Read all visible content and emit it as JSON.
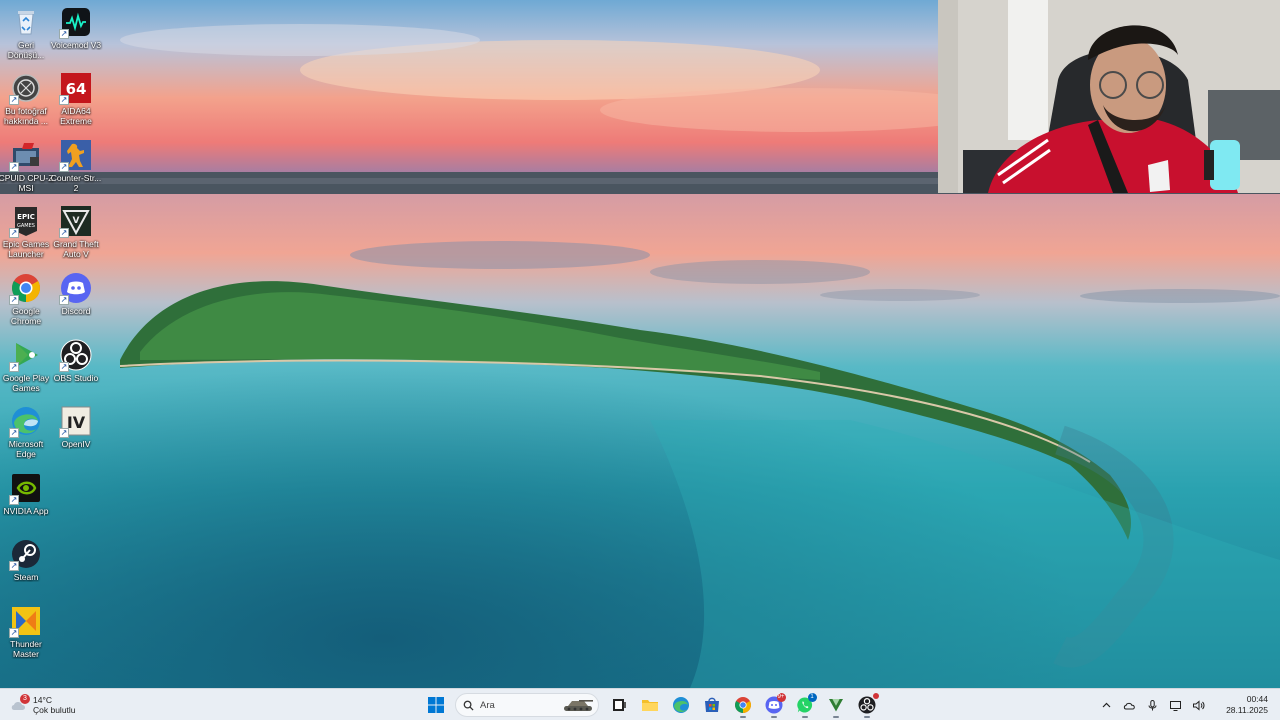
{
  "desktop_icons": [
    {
      "label": "Geri\nDönüşü...",
      "icon": "recycle-bin-icon"
    },
    {
      "label": "Voicemod V3",
      "icon": "voicemod-icon"
    },
    {
      "label": "Bu fotoğraf\nhakkında ...",
      "icon": "about-photo-icon"
    },
    {
      "label": "AIDA64\nExtreme",
      "icon": "aida64-icon"
    },
    {
      "label": "CPUID CPU-Z\nMSI",
      "icon": "cpuz-icon"
    },
    {
      "label": "Counter-Str...\n2",
      "icon": "counter-strike-icon"
    },
    {
      "label": "Epic Games\nLauncher",
      "icon": "epic-games-icon"
    },
    {
      "label": "Grand Theft\nAuto V",
      "icon": "gta-icon"
    },
    {
      "label": "Google\nChrome",
      "icon": "chrome-icon"
    },
    {
      "label": "Discord",
      "icon": "discord-icon"
    },
    {
      "label": "Google Play\nGames",
      "icon": "google-play-games-icon"
    },
    {
      "label": "OBS Studio",
      "icon": "obs-icon"
    },
    {
      "label": "Microsoft\nEdge",
      "icon": "edge-icon"
    },
    {
      "label": "OpenIV",
      "icon": "openiv-icon"
    },
    {
      "label": "NVIDIA App",
      "icon": "nvidia-icon"
    },
    {
      "label": "Steam",
      "icon": "steam-icon"
    },
    {
      "label": "Thunder\nMaster",
      "icon": "thunder-master-icon"
    }
  ],
  "taskbar": {
    "weather": {
      "temp": "14°C",
      "condition": "Çok bulutlu",
      "badge": "3"
    },
    "search": {
      "placeholder": "Ara"
    },
    "apps": [
      {
        "name": "start-button",
        "icon": "windows-logo-icon"
      },
      {
        "name": "task-view",
        "icon": "task-view-icon"
      },
      {
        "name": "file-explorer",
        "icon": "folder-icon"
      },
      {
        "name": "edge",
        "icon": "edge-icon"
      },
      {
        "name": "microsoft-store",
        "icon": "store-icon"
      },
      {
        "name": "chrome",
        "icon": "chrome-icon"
      },
      {
        "name": "discord",
        "icon": "discord-icon"
      },
      {
        "name": "whatsapp",
        "icon": "whatsapp-icon"
      },
      {
        "name": "vectorworks",
        "icon": "v-logo-icon"
      },
      {
        "name": "obs",
        "icon": "obs-icon"
      }
    ],
    "badges": {
      "discord": "9+",
      "whatsapp": "1"
    },
    "tray": [
      "chevron-up-icon",
      "onedrive-cloud-icon",
      "microphone-icon",
      "display-icon",
      "speaker-icon"
    ],
    "clock": {
      "time": "00:44",
      "date": "28.11.2025"
    }
  },
  "colors": {
    "taskbar_bg": "#e9eef4",
    "sky_top": "#7fb8d8",
    "sky_sunset": "#f08a78",
    "water": "#1f8fa0",
    "accent_blue": "#0067c0"
  }
}
